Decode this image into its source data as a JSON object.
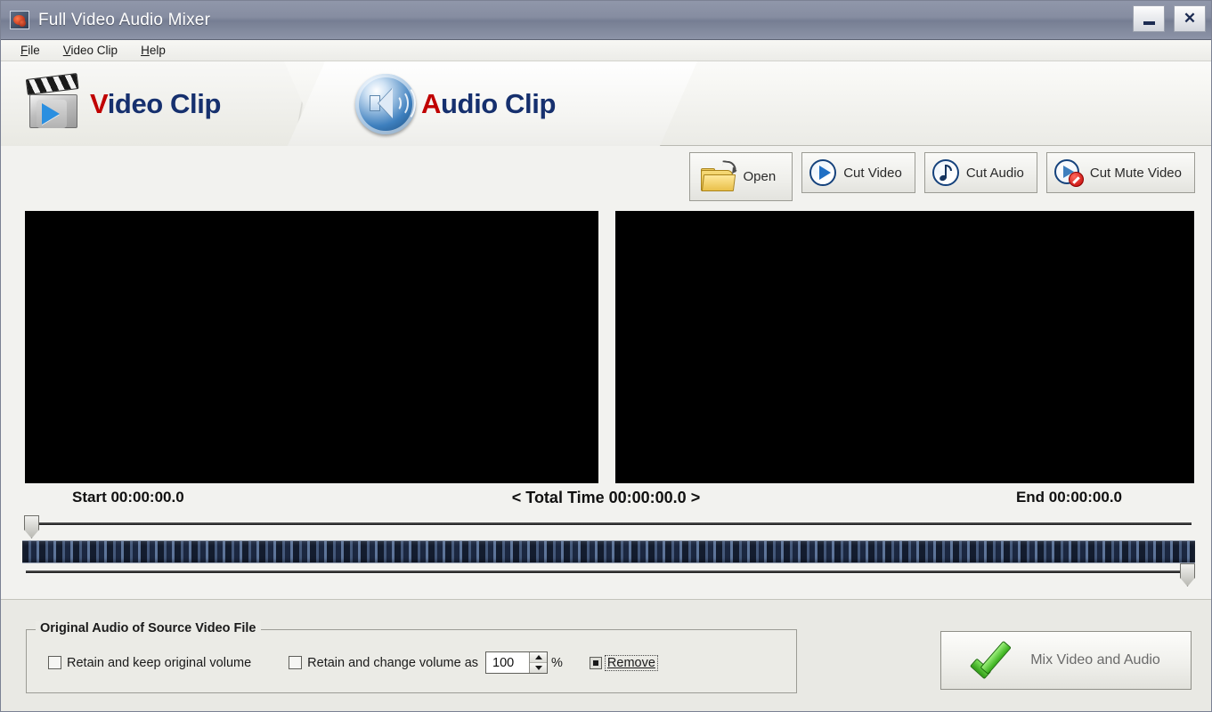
{
  "window": {
    "title": "Full Video Audio Mixer",
    "icon": "app-icon",
    "minimize_label": "",
    "close_label": "✕"
  },
  "menu": {
    "items": [
      {
        "label": "File",
        "mnemonic": "F"
      },
      {
        "label": "Video Clip",
        "mnemonic": "V"
      },
      {
        "label": "Help",
        "mnemonic": "H"
      }
    ]
  },
  "tabs": [
    {
      "id": "video-clip",
      "cap": "V",
      "rest": "ideo Clip",
      "icon": "clapperboard-icon",
      "active": false
    },
    {
      "id": "audio-clip",
      "cap": "A",
      "rest": "udio Clip",
      "icon": "speaker-icon",
      "active": true
    }
  ],
  "toolbar": {
    "open_label": "Open",
    "cut_video_label": "Cut Video",
    "cut_audio_label": "Cut Audio",
    "cut_mute_video_label": "Cut Mute Video"
  },
  "timeline": {
    "start_label": "Start 00:00:00.0",
    "total_label": "< Total Time 00:00:00.0 >",
    "end_label": "End 00:00:00.0"
  },
  "original_audio": {
    "group_title": "Original Audio of Source Video File",
    "retain_keep_label": "Retain and keep original volume",
    "retain_keep_checked": false,
    "retain_change_label": "Retain and change volume as",
    "retain_change_checked": false,
    "volume_value": "100",
    "percent_label": "%",
    "remove_label": "Remove",
    "remove_selected": true
  },
  "mix": {
    "label": "Mix Video and Audio",
    "icon": "green-check-icon"
  },
  "colors": {
    "title_bar": "#868da1",
    "tab_text_accent": "#c00000",
    "tab_text_main": "#16306e",
    "filmstrip_dark": "#131c2e",
    "filmstrip_light": "#5d7499",
    "preview_bg": "#000000",
    "check_green": "#35ae18"
  }
}
